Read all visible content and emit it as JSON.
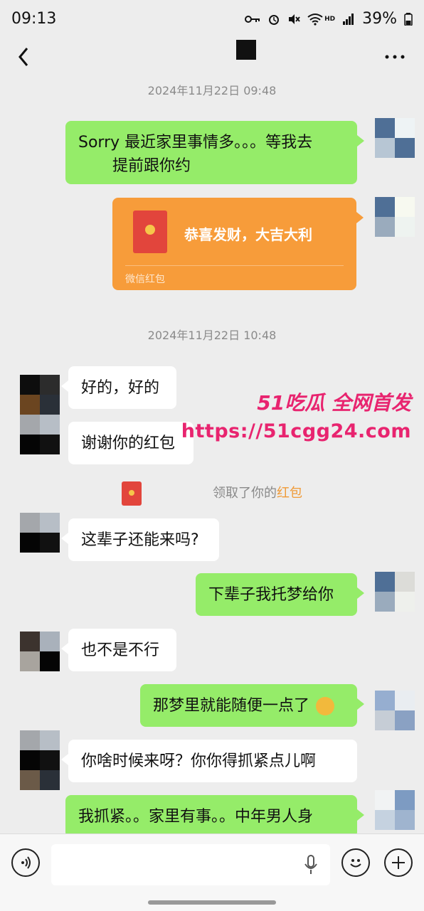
{
  "status": {
    "time": "09:13",
    "battery": "39%",
    "hd": "HD"
  },
  "messages": [
    {
      "timestamp": "2024年11月22日 09:48"
    },
    {
      "me_text_1": "Sorry 最近家里事情多。。。等我去",
      "me_text_2": "提前跟你约"
    },
    {
      "red_packet_title": "恭喜发财，大吉大利",
      "red_packet_label": "微信红包"
    },
    {
      "timestamp": "2024年11月22日 10:48"
    },
    {
      "them_1": "好的，好的"
    },
    {
      "them_2": "谢谢你的红包"
    },
    {
      "system": {
        "prefix": "领取了你的",
        "highlight": "红包"
      }
    },
    {
      "them_3": "这辈子还能来吗?"
    },
    {
      "me_2": "下辈子我托梦给你"
    },
    {
      "them_4": "也不是不行"
    },
    {
      "me_3": "那梦里就能随便一点了"
    },
    {
      "them_5": "你啥时候来呀？你你得抓紧点儿啊"
    },
    {
      "me_4": "我抓紧。。家里有事。。中年男人身"
    }
  ],
  "watermark": {
    "line1": "51吃瓜 全网首发",
    "line2": "https://51cgg24.com"
  },
  "colors": {
    "me_bubble": "#95ec69",
    "them_bubble": "#ffffff",
    "red_packet": "#f79c3a",
    "watermark": "#e8246f"
  },
  "icons": [
    "back-icon",
    "more-icon",
    "key-icon",
    "alarm-icon",
    "mute-icon",
    "wifi-icon",
    "signal-icon",
    "battery-icon",
    "voice-icon",
    "mic-icon",
    "emoji-icon",
    "plus-icon"
  ]
}
